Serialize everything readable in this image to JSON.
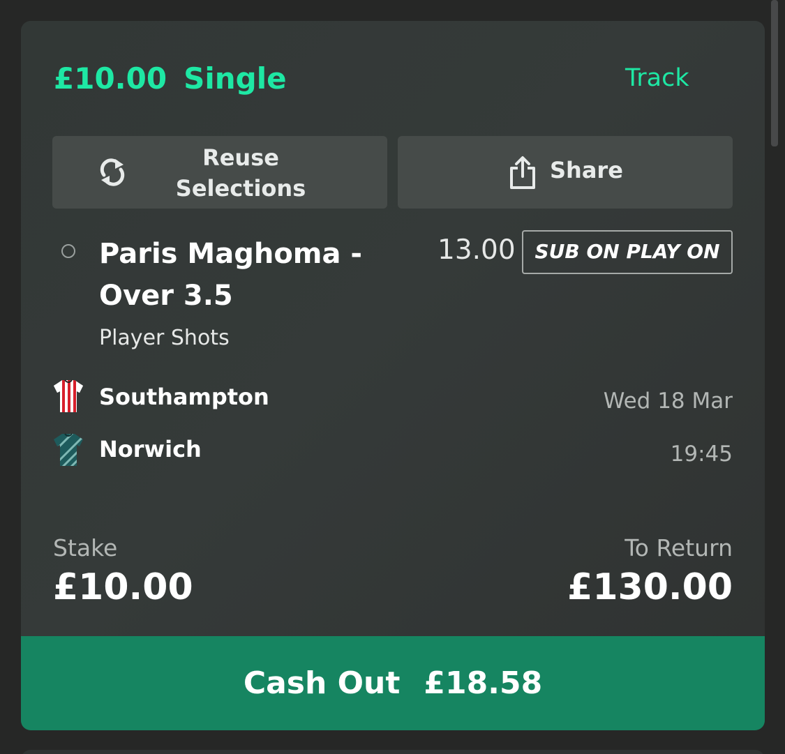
{
  "bet": {
    "stake_amount": "£10.00",
    "bet_type": "Single",
    "track_label": "Track"
  },
  "actions": {
    "reuse_line1": "Reuse",
    "reuse_line2": "Selections",
    "share_label": "Share"
  },
  "selection": {
    "name_line1": "Paris Maghoma -",
    "name_line2": "Over 3.5",
    "market": "Player Shots",
    "odds": "13.00",
    "badge": "SUB ON PLAY ON"
  },
  "event": {
    "home_team": "Southampton",
    "away_team": "Norwich",
    "date": "Wed 18 Mar",
    "time": "19:45"
  },
  "summary": {
    "stake_label": "Stake",
    "stake_value": "£10.00",
    "return_label": "To Return",
    "return_value": "£130.00"
  },
  "cashout": {
    "label": "Cash Out",
    "amount": "£18.58"
  },
  "colors": {
    "accent": "#1ee8a4",
    "cashout_bg": "#168561",
    "card_bg": "#333837"
  }
}
